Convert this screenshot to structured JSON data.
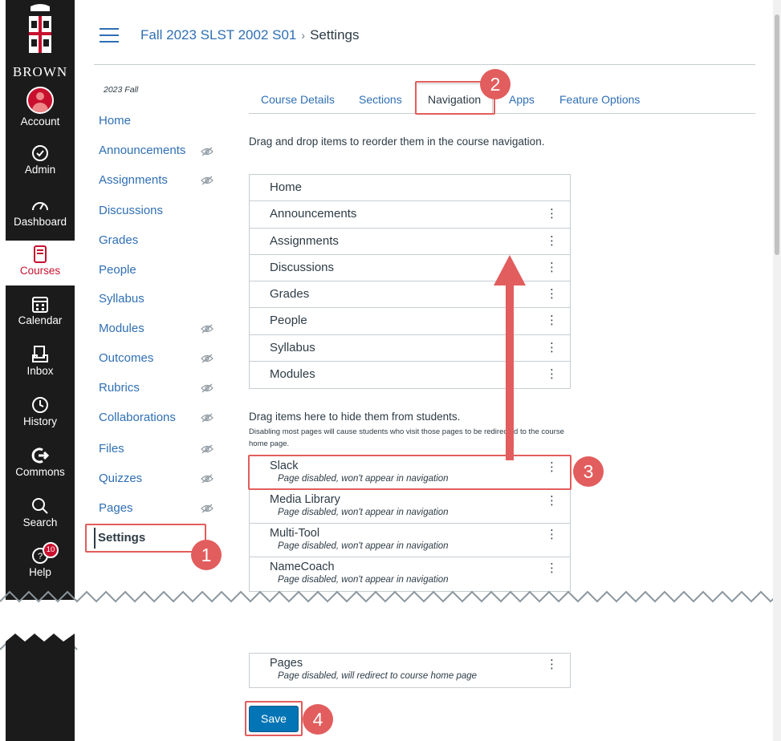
{
  "brand": {
    "name": "BROWN"
  },
  "global_nav": [
    {
      "label": "Account",
      "icon": "account-avatar"
    },
    {
      "label": "Admin",
      "icon": "shield-icon"
    },
    {
      "label": "Dashboard",
      "icon": "speedometer-icon"
    },
    {
      "label": "Courses",
      "icon": "book-icon"
    },
    {
      "label": "Calendar",
      "icon": "calendar-icon"
    },
    {
      "label": "Inbox",
      "icon": "inbox-icon"
    },
    {
      "label": "History",
      "icon": "clock-icon"
    },
    {
      "label": "Commons",
      "icon": "share-arrow-icon"
    },
    {
      "label": "Search",
      "icon": "search-icon"
    },
    {
      "label": "Help",
      "icon": "help-icon",
      "badge": "10"
    }
  ],
  "breadcrumb": {
    "course": "Fall 2023 SLST 2002 S01",
    "separator": "›",
    "current": "Settings"
  },
  "course_nav": {
    "term": "2023 Fall",
    "items": [
      {
        "label": "Home",
        "hidden": false
      },
      {
        "label": "Announcements",
        "hidden": true
      },
      {
        "label": "Assignments",
        "hidden": true
      },
      {
        "label": "Discussions",
        "hidden": false
      },
      {
        "label": "Grades",
        "hidden": false
      },
      {
        "label": "People",
        "hidden": false
      },
      {
        "label": "Syllabus",
        "hidden": false
      },
      {
        "label": "Modules",
        "hidden": true
      },
      {
        "label": "Outcomes",
        "hidden": true
      },
      {
        "label": "Rubrics",
        "hidden": true
      },
      {
        "label": "Collaborations",
        "hidden": true
      },
      {
        "label": "Files",
        "hidden": true
      },
      {
        "label": "Quizzes",
        "hidden": true
      },
      {
        "label": "Pages",
        "hidden": true
      }
    ],
    "active": "Settings"
  },
  "tabs": [
    "Course Details",
    "Sections",
    "Navigation",
    "Apps",
    "Feature Options"
  ],
  "active_tab": "Navigation",
  "instructions": "Drag and drop items to reorder them in the course navigation.",
  "enabled_items": [
    "Home",
    "Announcements",
    "Assignments",
    "Discussions",
    "Grades",
    "People",
    "Syllabus",
    "Modules"
  ],
  "hidden_section": {
    "title": "Drag items here to hide them from students.",
    "note": "Disabling most pages will cause students who visit those pages to be redirected to the course home page.",
    "items": [
      {
        "label": "Slack",
        "sub": "Page disabled, won't appear in navigation"
      },
      {
        "label": "Media Library",
        "sub": "Page disabled, won't appear in navigation"
      },
      {
        "label": "Multi-Tool",
        "sub": "Page disabled, won't appear in navigation"
      },
      {
        "label": "NameCoach",
        "sub": "Page disabled, won't appear in navigation"
      }
    ],
    "last_item": {
      "label": "Pages",
      "sub": "Page disabled, will redirect to course home page"
    }
  },
  "save_label": "Save",
  "step_markers": [
    "1",
    "2",
    "3",
    "4"
  ],
  "colors": {
    "link": "#2f6fb4",
    "highlight": "#e25d5d",
    "primary_button": "#0374b5",
    "nav_bg": "#1b1b1b",
    "brand_red": "#c8102e"
  }
}
